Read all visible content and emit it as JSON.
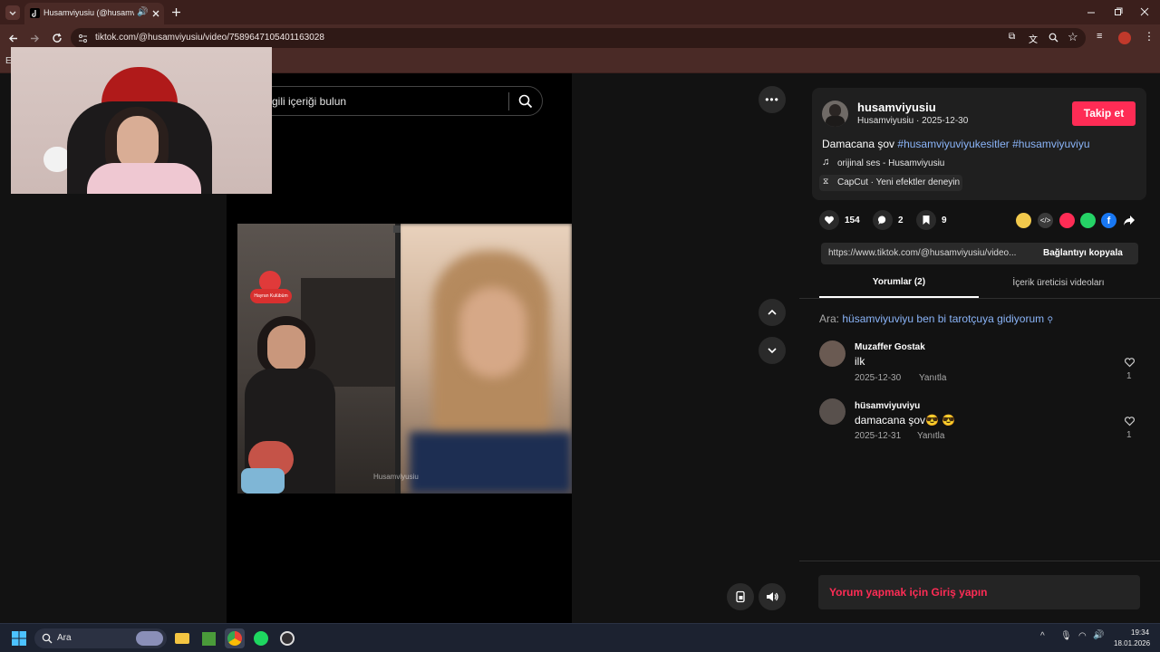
{
  "browser": {
    "tab_title": "Husamviyusiu (@husamviy",
    "url": "tiktok.com/@husamviyusiu/video/7589647105401163028",
    "bookmarks_initial": "E"
  },
  "search": {
    "placeholder": "gili içeriği bulun"
  },
  "video": {
    "watermark": "Husamviyusiu",
    "sticker_text": "Hayran Kulübüm"
  },
  "creator": {
    "username": "husamviyusiu",
    "display_line": "Husamviyusiu · 2025-12-30",
    "follow_label": "Takip et",
    "caption_text": "Damacana şov",
    "hashtag1": "#husamviyuviyukesitler",
    "hashtag2": "#husamviyuviyu",
    "music": "orijinal ses - Husamviyusiu",
    "effect": "CapCut · Yeni efektler deneyin"
  },
  "stats": {
    "likes": "154",
    "comments": "2",
    "saves": "9"
  },
  "share": {
    "link_text": "https://www.tiktok.com/@husamviyusiu/video...",
    "copy_label": "Bağlantıyı kopyala"
  },
  "tabs": {
    "comments": "Yorumlar (2)",
    "creator_videos": "İçerik üreticisi videoları"
  },
  "related_search": {
    "prefix": "Ara:",
    "query": "hüsamviyuviyu ben bi tarotçuya gidiyorum"
  },
  "comments": [
    {
      "name": "Muzaffer Gostak",
      "text": "ilk",
      "date": "2025-12-30",
      "reply": "Yanıtla",
      "likes": "1"
    },
    {
      "name": "hüsamviyuviyu",
      "text": "damacana şov😎 😎",
      "date": "2025-12-31",
      "reply": "Yanıtla",
      "likes": "1"
    }
  ],
  "login_prompt": "Yorum yapmak için Giriş yapın",
  "taskbar": {
    "search_label": "Ara",
    "time": "19:34",
    "date": "18.01.2026"
  },
  "colors": {
    "accent": "#fe2c55",
    "hashtag": "#8ab4f8"
  }
}
